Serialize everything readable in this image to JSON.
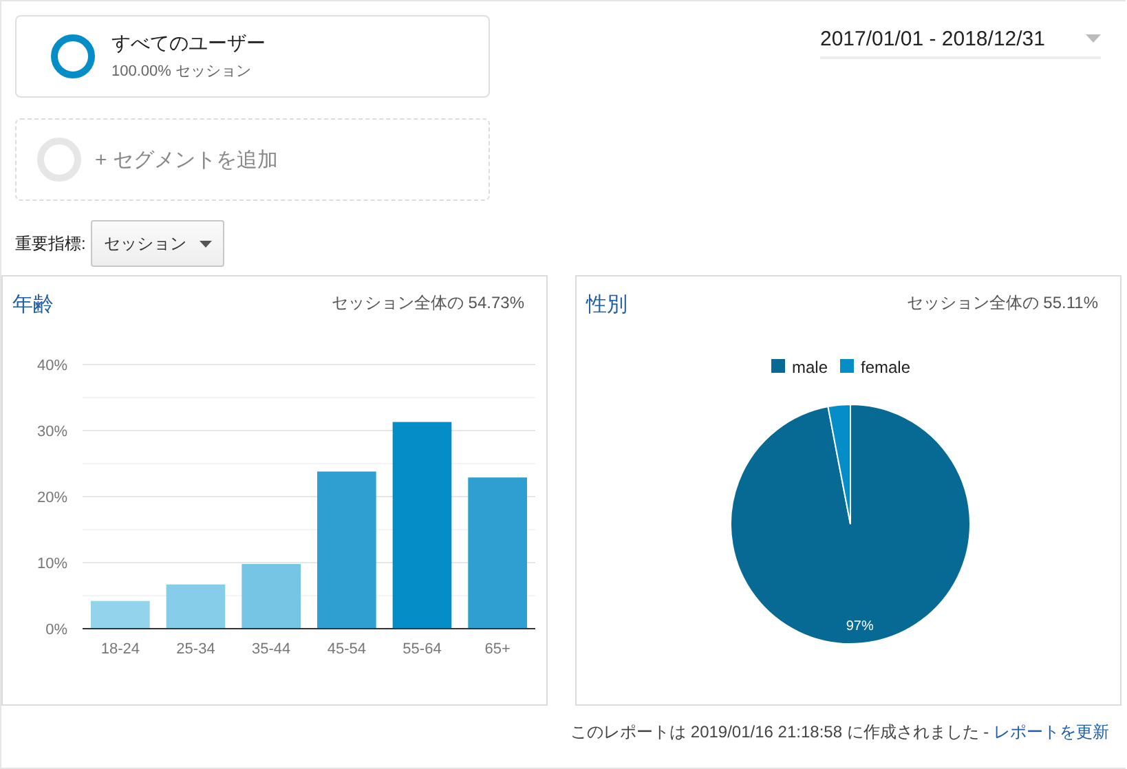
{
  "segments": [
    {
      "kind": "active",
      "title": "すべてのユーザー",
      "subtitle": "100.00% セッション"
    },
    {
      "kind": "add",
      "title": "+ セグメントを追加"
    }
  ],
  "date_range": {
    "value": "2017/01/01 - 2018/12/31"
  },
  "key_metric": {
    "label": "重要指標:",
    "value": "セッション"
  },
  "panels": [
    {
      "title": "年齢",
      "summary": "セッション全体の 54.73%",
      "chart_data": {
        "type": "bar",
        "categories": [
          "18-24",
          "25-34",
          "35-44",
          "45-54",
          "55-64",
          "65+"
        ],
        "series": [
          {
            "colors": [
              "#93d4ec",
              "#86cde9",
              "#77c5e5",
              "#2f9fd1",
              "#058dc7",
              "#2f9fd1"
            ],
            "values": [
              4.2,
              6.7,
              9.8,
              23.8,
              31.3,
              22.9
            ]
          }
        ],
        "grid": true,
        "ylim": [
          0,
          40
        ],
        "yticks": [
          {
            "value": 0,
            "label": "0%"
          },
          {
            "value": 10,
            "label": "10%"
          },
          {
            "value": 20,
            "label": "20%"
          },
          {
            "value": 30,
            "label": "30%"
          },
          {
            "value": 40,
            "label": "40%"
          }
        ]
      }
    },
    {
      "title": "性別",
      "summary": "セッション全体の 55.11%",
      "chart_data": {
        "type": "pie",
        "categories": [
          "male",
          "female"
        ],
        "series": [
          {
            "values": [
              97,
              3
            ]
          }
        ],
        "colors": [
          "#066a94",
          "#058dc7"
        ],
        "legend": "top",
        "value_labels": [
          "97%",
          null
        ]
      }
    }
  ],
  "footer": {
    "text": "このレポートは 2019/01/16 21:18:58 に作成されました - ",
    "link": "レポートを更新"
  }
}
